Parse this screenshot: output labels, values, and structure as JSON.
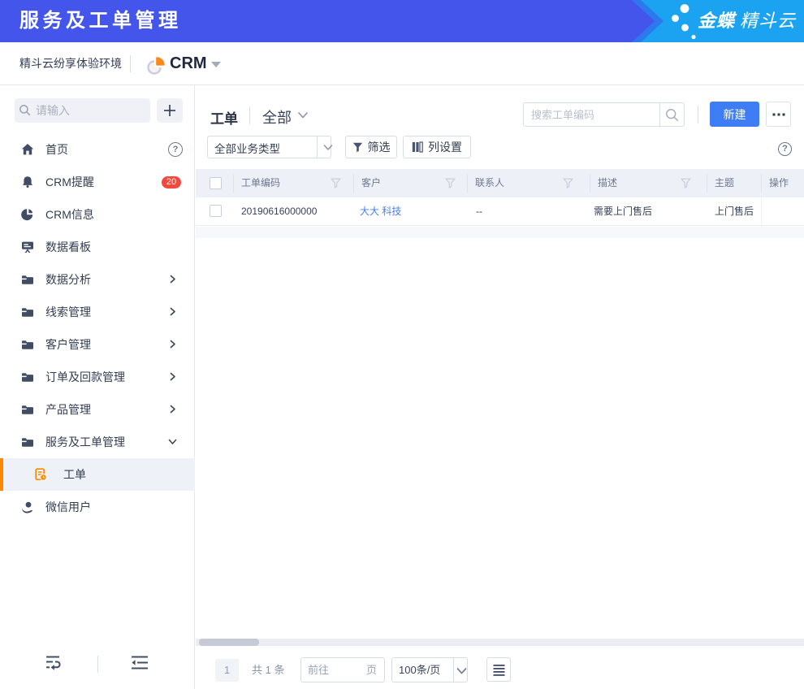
{
  "topbar": {
    "title": "服务及工单管理",
    "brand_bold": "金蝶",
    "brand_light": "精斗云",
    "colors": {
      "primary_blue": "#4355EA",
      "band_blue": "#2B79EC",
      "light_blue": "#1BA3F1"
    }
  },
  "envbar": {
    "environment": "精斗云纷享体验环境",
    "app": "CRM"
  },
  "sidebar": {
    "search_placeholder": "请输入",
    "items": [
      {
        "label": "首页",
        "icon": "home-icon",
        "trailing": "help-icon"
      },
      {
        "label": "CRM提醒",
        "icon": "bell-icon",
        "badge": "20"
      },
      {
        "label": "CRM信息",
        "icon": "pie-chart-icon"
      },
      {
        "label": "数据看板",
        "icon": "dashboard-icon"
      },
      {
        "label": "数据分析",
        "icon": "folder-icon",
        "trailing": "chevron-right-icon"
      },
      {
        "label": "线索管理",
        "icon": "folder-icon",
        "trailing": "chevron-right-icon"
      },
      {
        "label": "客户管理",
        "icon": "folder-icon",
        "trailing": "chevron-right-icon"
      },
      {
        "label": "订单及回款管理",
        "icon": "folder-icon",
        "trailing": "chevron-right-icon"
      },
      {
        "label": "产品管理",
        "icon": "folder-icon",
        "trailing": "chevron-right-icon"
      },
      {
        "label": "服务及工单管理",
        "icon": "folder-icon",
        "trailing": "chevron-down-icon"
      },
      {
        "label": "工单",
        "icon": "workorder-icon",
        "selected": true
      },
      {
        "label": "微信用户",
        "icon": "wechat-user-icon"
      }
    ],
    "bottom_icons": [
      "wrap-collapse-icon",
      "collapse-menu-icon"
    ]
  },
  "toolbar": {
    "title": "工单",
    "view": "全部",
    "search_placeholder": "搜索工单编码",
    "create": "新建"
  },
  "filterbar": {
    "business_type": "全部业务类型",
    "filter": "筛选",
    "column_settings": "列设置"
  },
  "table": {
    "headers": [
      "工单编码",
      "客户",
      "联系人",
      "描述",
      "主题",
      "操作"
    ],
    "row": {
      "code": "20190616000000",
      "customer": "大大 科技",
      "contact": "--",
      "description": "需要上门售后",
      "subject": "上门售后"
    }
  },
  "pagination": {
    "page": "1",
    "total": "共 1 条",
    "goto_prefix": "前往",
    "goto_suffix": "页",
    "page_size": "100条/页"
  },
  "colors": {
    "accent_blue": "#3F7DF4",
    "link_blue": "#4A7DF2",
    "orange": "#FC8800",
    "badge_red": "#F5483D"
  }
}
